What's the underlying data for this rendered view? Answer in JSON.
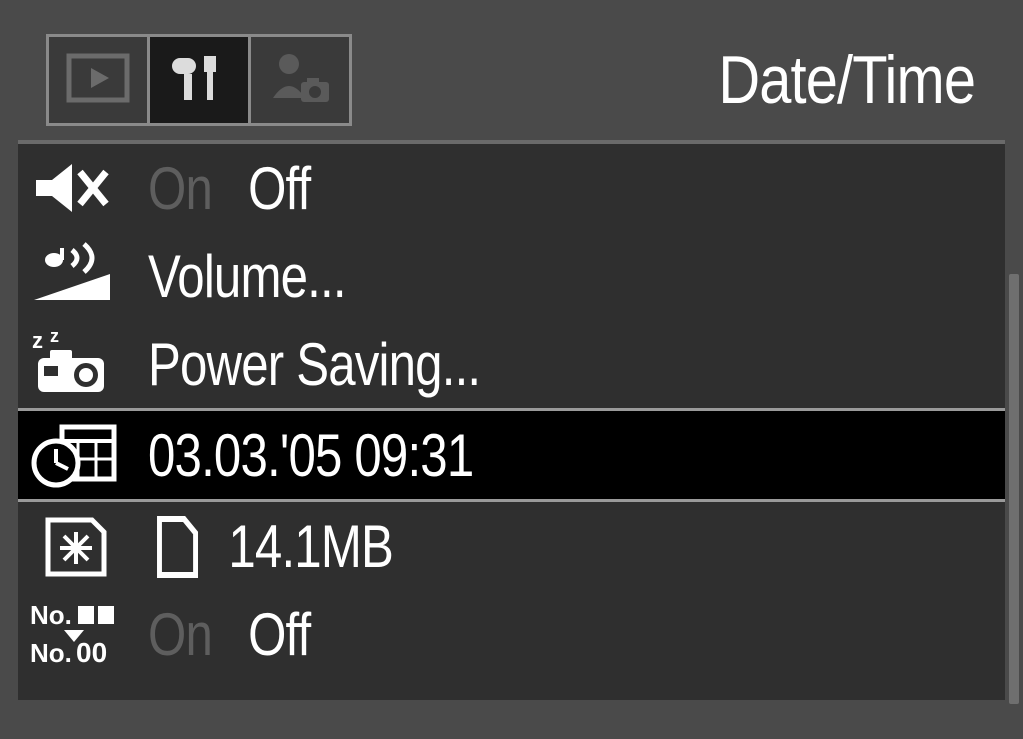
{
  "header": {
    "title": "Date/Time"
  },
  "tabs": {
    "playback": "playback",
    "setup": "setup",
    "mycamera": "mycamera"
  },
  "menu": {
    "mute": {
      "on": "On",
      "off": "Off"
    },
    "volume": {
      "label": "Volume..."
    },
    "powersaving": {
      "label": "Power Saving..."
    },
    "datetime": {
      "value": "03.03.'05 09:31"
    },
    "format": {
      "size": "14.1MB"
    },
    "filenoreset": {
      "on": "On",
      "off": "Off"
    }
  }
}
